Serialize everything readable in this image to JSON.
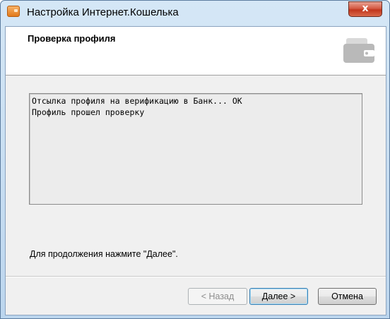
{
  "window": {
    "title": "Настройка Интернет.Кошелька",
    "close_glyph": "x",
    "icon": "wallet-app-icon"
  },
  "header": {
    "title": "Проверка профиля",
    "icon": "wallet-icon"
  },
  "log": {
    "lines": [
      "Отсылка профиля на верификацию в Банк... ОК",
      "Профиль прошел проверку"
    ]
  },
  "hint": "Для продолжения нажмите \"Далее\".",
  "buttons": {
    "back": "< Назад",
    "next": "Далее >",
    "cancel": "Отмена"
  },
  "colors": {
    "accent": "#3c7fb1",
    "close": "#c1361d"
  }
}
